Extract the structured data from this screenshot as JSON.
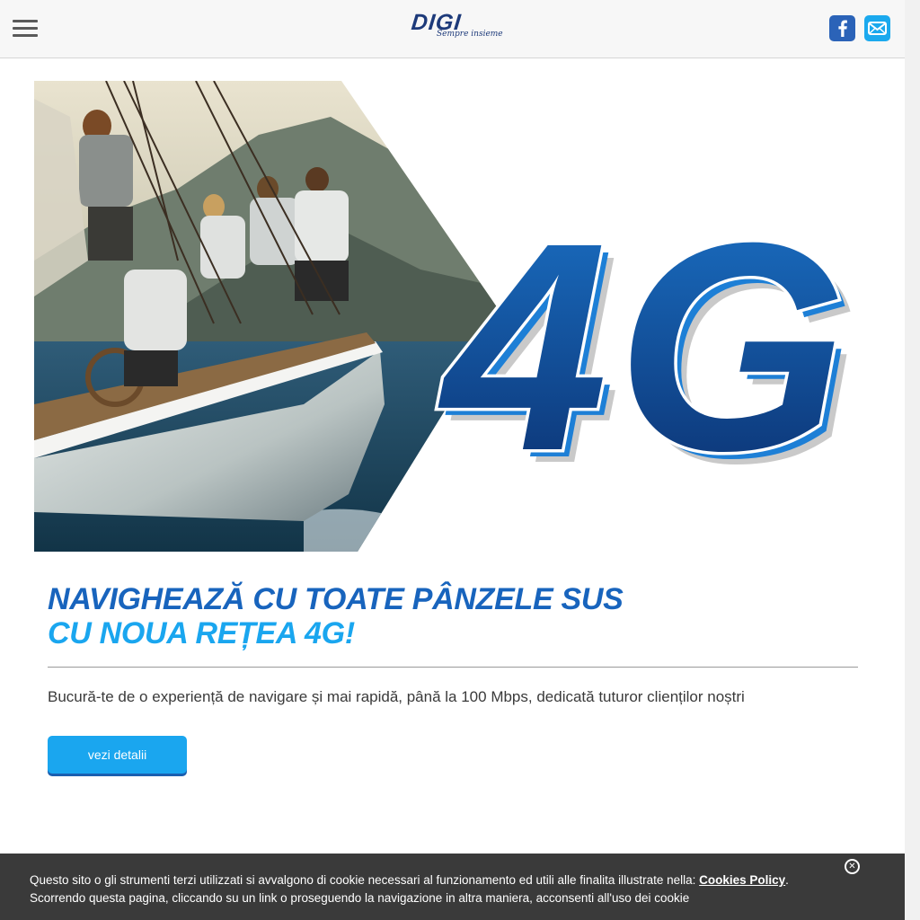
{
  "header": {
    "logo_text": "DIGI",
    "logo_tagline": "Sempre insieme",
    "menu_icon": "hamburger-menu-icon",
    "social": [
      {
        "name": "facebook",
        "icon": "facebook-icon"
      },
      {
        "name": "email",
        "icon": "mail-icon"
      }
    ]
  },
  "hero": {
    "badge_text": "4G",
    "image": "sailing-crew-on-yacht-photo"
  },
  "content": {
    "headline_line1": "NAVIGHEAZĂ CU TOATE PÂNZELE SUS",
    "headline_line2": "CU NOUA REȚEA 4G!",
    "description": "Bucură-te de o experiență de navigare și mai rapidă, până la 100 Mbps, dedicată tuturor clienților noștri",
    "cta_label": "vezi detalii"
  },
  "cookie_banner": {
    "line1_prefix": "Questo sito o gli strumenti terzi utilizzati si avvalgono di cookie necessari al funzionamento ed utili alle finalita illustrate nella: ",
    "policy_link": "Cookies Policy",
    "line1_suffix": ".",
    "line2": "Scorrendo questa pagina, cliccando su un link o proseguendo la navigazione in altra maniera, acconsenti all'uso dei cookie",
    "close_icon": "close-circle-icon"
  },
  "colors": {
    "brand_dark": "#1d3a7a",
    "headline_blue": "#1864bd",
    "accent_blue": "#1aa6ef",
    "cookie_bg": "#3a3a3a"
  }
}
